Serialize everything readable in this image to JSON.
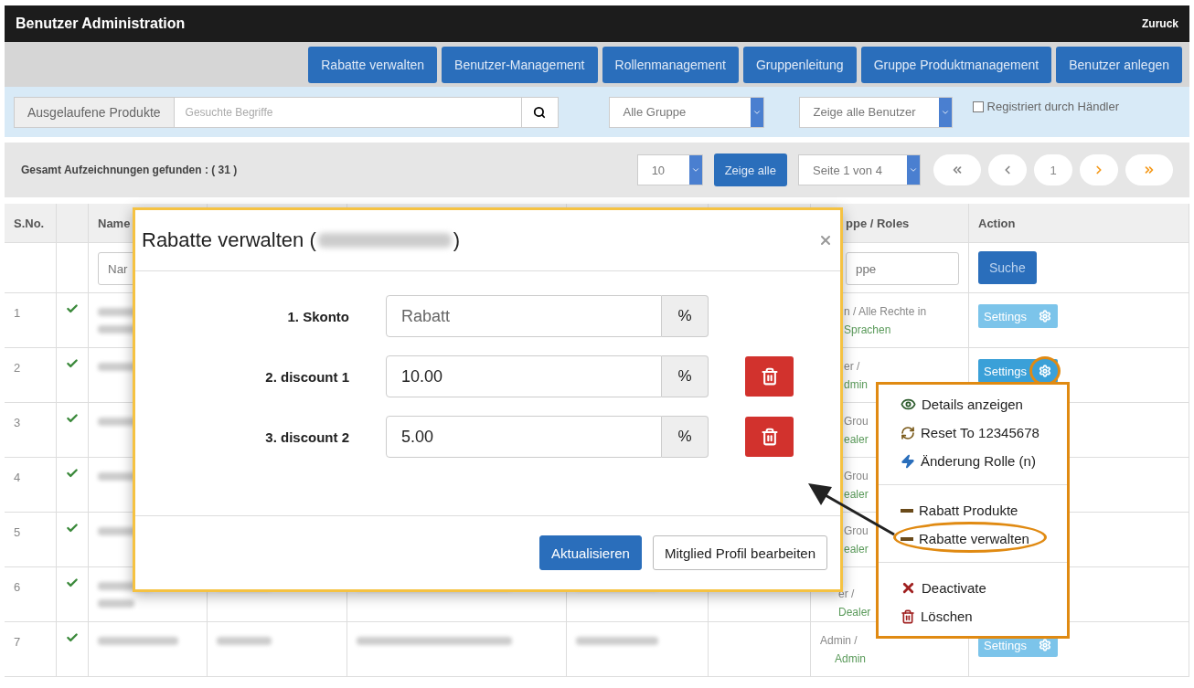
{
  "header": {
    "title": "Benutzer Administration",
    "back": "Zuruck"
  },
  "nav": [
    "Rabatte verwalten",
    "Benutzer-Management",
    "Rollenmanagement",
    "Gruppenleitung",
    "Gruppe Produktmanagement",
    "Benutzer anlegen"
  ],
  "filters": {
    "category": "Ausgelaufene Produkte",
    "search": {
      "placeholder": "Gesuchte Begriffe"
    },
    "group_select": "Alle Gruppe",
    "user_select": "Zeige alle Benutzer",
    "dealer": {
      "label": "Registriert durch Händler",
      "checked": false
    }
  },
  "pager": {
    "total": "Gesamt Aufzeichnungen gefunden : ( 31 )",
    "page_size": "10",
    "show_all": "Zeige alle",
    "page_select": "Seite 1 von 4",
    "buttons": [
      {
        "kind": "first",
        "disabled": true
      },
      {
        "kind": "prev",
        "disabled": true
      },
      {
        "kind": "page",
        "label": "1"
      },
      {
        "kind": "next",
        "disabled": false
      },
      {
        "kind": "last",
        "disabled": false
      }
    ]
  },
  "table": {
    "columns": [
      "S.No.",
      "Name",
      "ppe / Roles",
      "Action"
    ],
    "filter": {
      "name_placeholder": "Nar",
      "group_placeholder": "ppe",
      "search": "Suche"
    },
    "rows": [
      {
        "no": "1",
        "active": true,
        "group": [
          "n / Alle Rechte in",
          "Sprachen"
        ],
        "settings": "Settings",
        "focused": false
      },
      {
        "no": "2",
        "active": true,
        "group": [
          "er /",
          "dmin"
        ],
        "settings": "Settings",
        "focused": true
      },
      {
        "no": "3",
        "active": true,
        "group": [
          "Grou",
          "ealer"
        ]
      },
      {
        "no": "4",
        "active": true,
        "group": [
          "Grou",
          "ealer"
        ]
      },
      {
        "no": "5",
        "active": true,
        "group": [
          "Grou",
          "ealer"
        ]
      },
      {
        "no": "6",
        "active": true,
        "group": [
          "er /",
          "Dealer"
        ]
      },
      {
        "no": "7",
        "active": true,
        "group": [
          "Admin /",
          "Admin"
        ],
        "settings": "Settings",
        "focused": false
      }
    ]
  },
  "modal": {
    "title": "Rabatte verwalten (",
    "title_end": ")",
    "fields": [
      {
        "label": "1. Skonto",
        "placeholder": "Rabatt",
        "addon": "%",
        "deletable": false
      },
      {
        "label": "2. discount 1",
        "value": "10.00",
        "addon": "%",
        "deletable": true
      },
      {
        "label": "3. discount 2",
        "value": "5.00",
        "addon": "%",
        "deletable": true
      }
    ],
    "buttons": [
      {
        "label": "Aktualisieren",
        "kind": "primary"
      },
      {
        "label": "Mitglied Profil bearbeiten",
        "kind": "default"
      }
    ]
  },
  "menu": {
    "groups": [
      [
        {
          "label": "Details anzeigen",
          "circled": false
        },
        {
          "label": "Reset To 12345678",
          "circled": false
        },
        {
          "label": "Änderung Rolle (n)",
          "circled": false
        }
      ],
      [
        {
          "label": "Rabatt Produkte",
          "circled": false
        },
        {
          "label": "Rabatte verwalten",
          "circled": true
        }
      ],
      [
        {
          "label": "Deactivate",
          "circled": false
        },
        {
          "label": "Löschen",
          "circled": false
        }
      ]
    ]
  }
}
